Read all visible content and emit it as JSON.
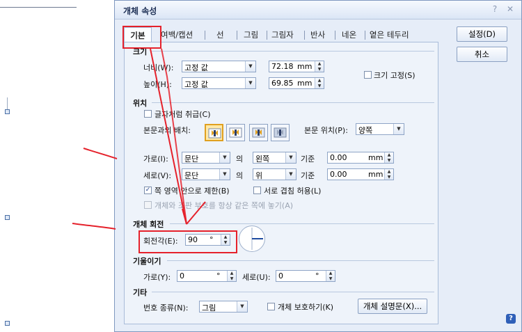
{
  "dialog": {
    "title": "개체 속성",
    "help_icon": "question-icon",
    "close_icon": "close-icon"
  },
  "tabs": [
    {
      "label": "기본",
      "active": true
    },
    {
      "label": "여백/캡션"
    },
    {
      "label": "선"
    },
    {
      "label": "그림"
    },
    {
      "label": "그림자"
    },
    {
      "label": "반사"
    },
    {
      "label": "네온"
    },
    {
      "label": "옅은 테두리"
    }
  ],
  "buttons": {
    "ok": "설정(D)",
    "cancel": "취소",
    "object_description": "개체 설명문(X)..."
  },
  "size": {
    "section": "크기",
    "width_label": "너비(W):",
    "width_mode": "고정 값",
    "width_value": "72.18",
    "height_label": "높이(H):",
    "height_mode": "고정 값",
    "height_value": "69.85",
    "unit": "mm",
    "fixed_label": "크기 고정(S)"
  },
  "position": {
    "section": "위치",
    "treat_as_char": "글자처럼 취급(C)",
    "wrap_label": "본문과의 배치:",
    "body_pos_label": "본문 위치(P):",
    "body_pos_value": "양쪽",
    "horizontal_label": "가로(I):",
    "horizontal_ref": "문단",
    "of": "의",
    "horizontal_align": "왼쪽",
    "basis": "기준",
    "horizontal_offset": "0.00",
    "vertical_label": "세로(V):",
    "vertical_ref": "문단",
    "vertical_align": "위",
    "vertical_offset": "0.00",
    "unit": "mm",
    "limit_in_page": "쪽 영역 안으로 제한(B)",
    "allow_overlap": "서로 겹침 허용(L)",
    "anchor_same_page": "개체와 조판 부호를 항상 같은 쪽에 놓기(A)"
  },
  "rotation": {
    "section": "개체 회전",
    "angle_label": "회전각(E):",
    "angle_value": "90",
    "angle_unit": "°"
  },
  "skew": {
    "section": "기울이기",
    "h_label": "가로(Y):",
    "h_value": "0",
    "v_label": "세로(U):",
    "v_value": "0",
    "unit": "°"
  },
  "etc": {
    "section": "기타",
    "number_type_label": "번호 종류(N):",
    "number_type_value": "그림",
    "protect_label": "개체 보호하기(K)"
  },
  "colors": {
    "annotation": "#e5212b",
    "dialog_bg": "#e6edf8"
  }
}
